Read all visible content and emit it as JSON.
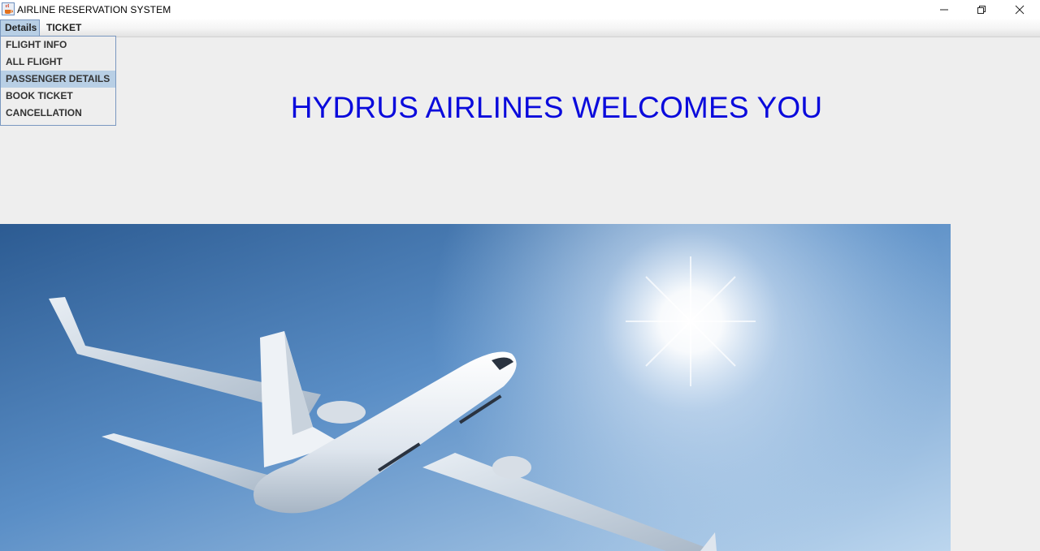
{
  "window": {
    "title": "AIRLINE RESERVATION SYSTEM",
    "icon": "java-coffee-icon",
    "controls": [
      "minimize-icon",
      "restore-icon",
      "close-icon"
    ]
  },
  "menubar": {
    "items": [
      "Details",
      "TICKET"
    ],
    "open_menu": "Details"
  },
  "details_menu": {
    "items": [
      "FLIGHT INFO",
      "ALL FLIGHT",
      "PASSENGER DETAILS",
      "BOOK TICKET",
      "CANCELLATION"
    ],
    "highlighted": "PASSENGER DETAILS"
  },
  "main": {
    "heading": "HYDRUS AIRLINES WELCOMES YOU",
    "heading_color": "#0a0adc",
    "image": "airplane-in-sky"
  },
  "colors": {
    "menu_highlight": "#b8cfe5",
    "menu_border": "#7a98c0",
    "background": "#eeeeee"
  }
}
